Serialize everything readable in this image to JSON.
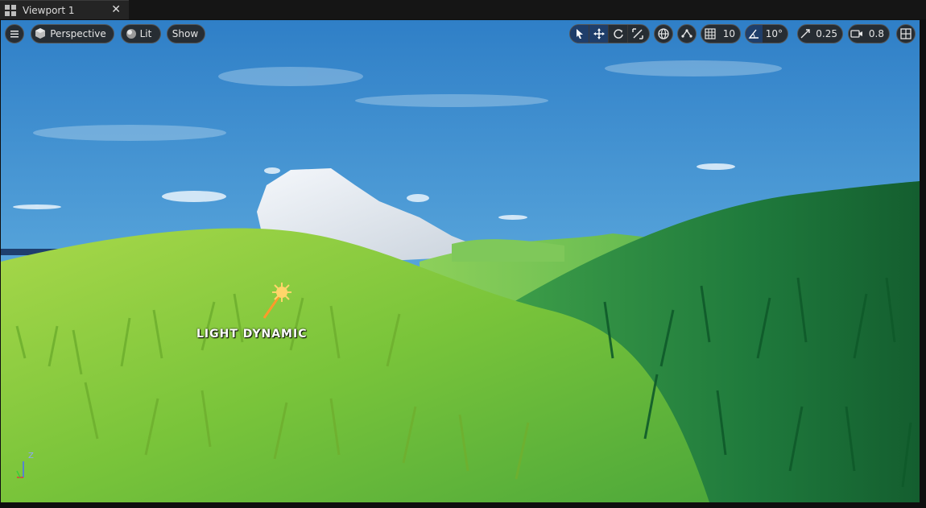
{
  "tab": {
    "title": "Viewport 1",
    "close": "✕"
  },
  "toolbar": {
    "view_mode": "Perspective",
    "lighting": "Lit",
    "show": "Show",
    "grid_snap": "10",
    "rotation_snap": "10°",
    "scale_snap": "0.25",
    "camera_speed": "0.8"
  },
  "scene_label": "LIGHT DYNAMIC",
  "axis": {
    "z": "Z"
  },
  "icons": [
    "hamburger-icon",
    "cube-icon",
    "lit-sphere-icon",
    "select-icon",
    "translate-icon",
    "rotate-icon",
    "scale-icon",
    "world-local-icon",
    "surface-snap-icon",
    "grid-icon",
    "angle-icon",
    "scale-snap-icon",
    "camera-icon",
    "layout-icon"
  ]
}
